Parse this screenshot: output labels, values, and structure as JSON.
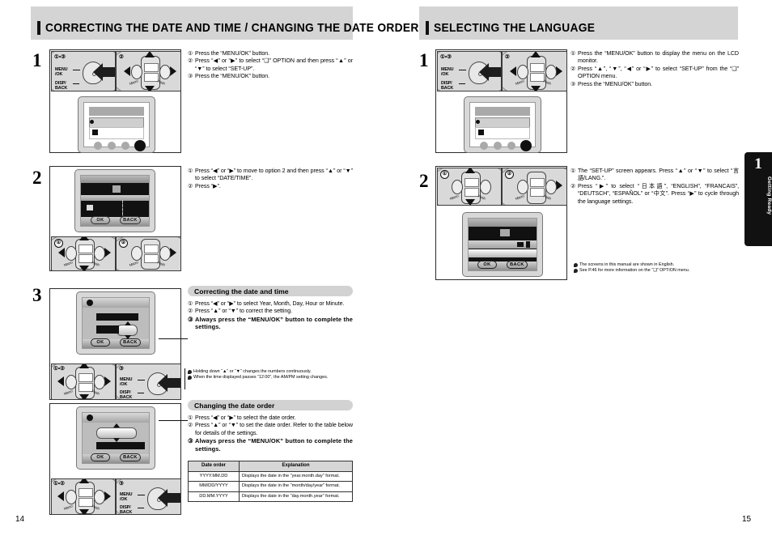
{
  "left_page": {
    "number": "14",
    "header": "CORRECTING THE DATE AND TIME / CHANGING THE DATE ORDER",
    "steps": [
      {
        "num": "1",
        "instructions": [
          {
            "n": "①",
            "text": "Press the “MENU/OK” button."
          },
          {
            "n": "②",
            "text": "Press “◀” or “▶” to select “❑” OPTION and then press “▲” or “▼” to select “SET-UP”."
          },
          {
            "n": "③",
            "text": "Press the “MENU/OK” button."
          }
        ],
        "pad_labels": {
          "menu": "MENU\n/OK",
          "disp": "DISP/\nBACK",
          "badge_a": "①•③",
          "badge_b": "②"
        }
      },
      {
        "num": "2",
        "instructions": [
          {
            "n": "①",
            "text": "Press “◀” or “▶” to move to option 2 and then press “▲” or “▼” to select “DATE/TIME”."
          },
          {
            "n": "②",
            "text": "Press “▶”."
          }
        ],
        "screen_buttons": {
          "ok": "OK",
          "back": "BACK"
        },
        "badges": [
          "①",
          "②"
        ]
      },
      {
        "num": "3",
        "badges": [
          "①•②",
          "③"
        ],
        "screen_buttons": {
          "ok": "OK",
          "back": "BACK"
        },
        "pad_labels": {
          "menu": "MENU\n/OK",
          "disp": "DISP/\nBACK"
        }
      }
    ],
    "section_correcting": {
      "title": "Correcting the date and time",
      "instructions": [
        {
          "n": "①",
          "text": "Press “◀” or “▶” to select Year, Month, Day, Hour or Minute.",
          "bold": false
        },
        {
          "n": "②",
          "text": "Press “▲” or “▼” to correct the setting.",
          "bold": false
        },
        {
          "n": "③",
          "text": "Always press the “MENU/OK” button to complete the settings.",
          "bold": true
        }
      ],
      "notes": [
        "Holding down “▲” or “▼” changes the numbers continuously.",
        "When the time displayed passes “12:00”, the AM/PM setting changes."
      ]
    },
    "section_order": {
      "title": "Changing the date order",
      "instructions": [
        {
          "n": "①",
          "text": "Press “◀” or “▶” to select the date order.",
          "bold": false
        },
        {
          "n": "②",
          "text": "Press “▲” or “▼” to set the date order. Refer to the table below for details of the settings.",
          "bold": false
        },
        {
          "n": "③",
          "text": "Always press the “MENU/OK” button to complete the settings.",
          "bold": true
        }
      ],
      "table": {
        "headers": [
          "Date order",
          "Explanation"
        ],
        "rows": [
          [
            "YYYY.MM.DD",
            "Displays the date in the “year.month.day” format."
          ],
          [
            "MM/DD/YYYY",
            "Displays the date in the “month/day/year” format."
          ],
          [
            "DD.MM.YYYY",
            "Displays the date in the “day.month.year” format."
          ]
        ]
      }
    }
  },
  "right_page": {
    "number": "15",
    "header": "SELECTING THE LANGUAGE",
    "steps": [
      {
        "num": "1",
        "instructions": [
          {
            "n": "①",
            "text": "Press the “MENU/OK” button to display the menu on the LCD monitor."
          },
          {
            "n": "②",
            "text": "Press “▲”, “▼”, “◀” or “▶” to select “SET-UP” from the “❑” OPTION menu."
          },
          {
            "n": "③",
            "text": "Press the “MENU/OK” button."
          }
        ],
        "pad_labels": {
          "menu": "MENU\n/OK",
          "disp": "DISP/\nBACK",
          "badge_a": "①•③",
          "badge_b": "②"
        }
      },
      {
        "num": "2",
        "instructions": [
          {
            "n": "①",
            "text": "The “SET-UP” screen appears. Press “▲” or “▼” to select “言語/LANG.”."
          },
          {
            "n": "②",
            "text": "Press “▶” to select “日本語”, “ENGLISH”, “FRANCAIS”, “DEUTSCH”, “ESPAÑOL” or “中文”. Press “▶” to cycle through the language settings."
          }
        ],
        "badges": [
          "①",
          "②"
        ],
        "screen_buttons": {
          "ok": "OK",
          "back": "BACK"
        }
      }
    ],
    "notes": [
      "The screens in this manual are shown in English.",
      "See P.46 for more information on the “❑” OPTION menu."
    ]
  },
  "chapter_tab": {
    "number": "1",
    "label": "Getting Ready"
  }
}
